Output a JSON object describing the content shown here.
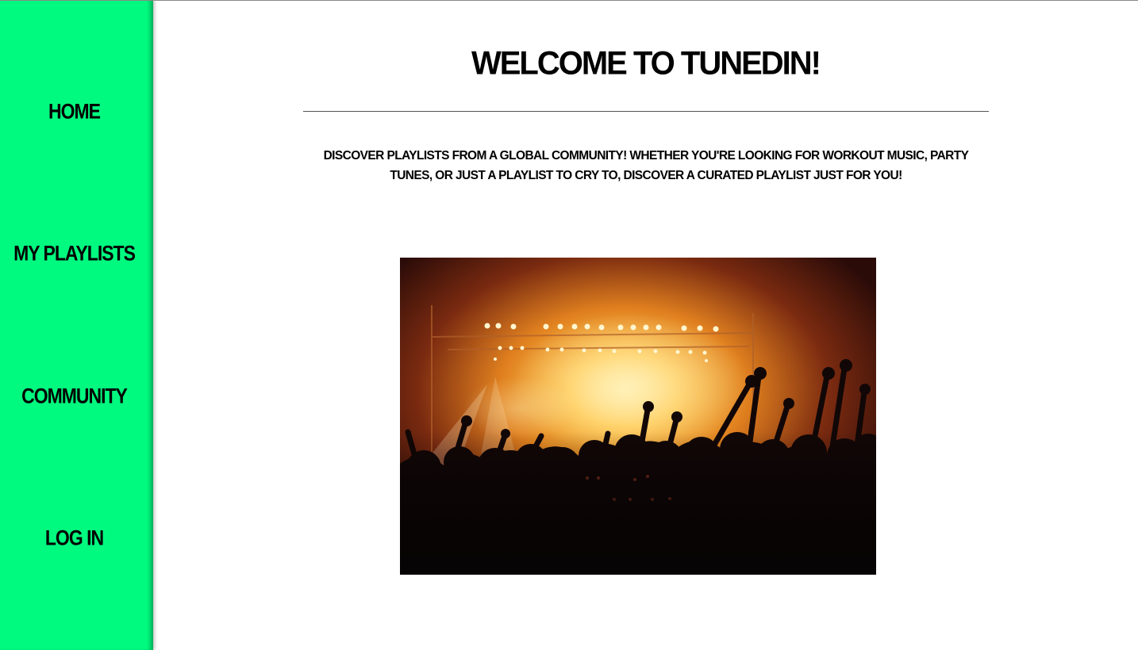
{
  "nav": {
    "items": [
      {
        "label": "Home"
      },
      {
        "label": "My Playlists"
      },
      {
        "label": "Community"
      },
      {
        "label": "Log In"
      }
    ]
  },
  "main": {
    "title": "Welcome to TunedIn!",
    "intro": "Discover playlists from a global community! Whether you're looking for workout music, party tunes, or just a playlist to cry to, discover a curated playlist just for you!"
  },
  "colors": {
    "sidebar": "#00fa7f",
    "text": "#000000",
    "background": "#ffffff"
  }
}
